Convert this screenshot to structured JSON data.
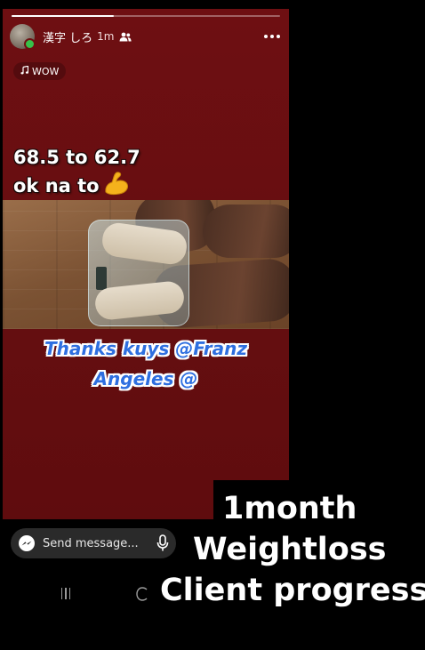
{
  "story": {
    "progress_fraction": 0.38,
    "header": {
      "username": "漢字 しろ",
      "time": "1m",
      "friends_icon": "friends-icon",
      "more_icon": "more-icon"
    },
    "music": {
      "icon": "music-note-icon",
      "label": "WOW"
    },
    "caption": {
      "line1": "68.5 to 62.7",
      "line2": "ok na to",
      "emoji": "💪"
    },
    "thanks": {
      "line1": "Thanks kuys @Franz",
      "line2": "Angeles  @"
    },
    "colors": {
      "background": "#6e0f12",
      "thanks_text": "#2e6fe0",
      "online_dot": "#37c24a"
    }
  },
  "reply": {
    "placeholder": "Send message...",
    "left_icon": "messenger-icon",
    "right_icon": "mic-icon"
  },
  "overlay": {
    "line1": "1month",
    "line2": "Weightloss",
    "line3": "Client progress"
  },
  "system_nav": {
    "recent_icon": "recent-apps-icon",
    "home_icon": "home-icon"
  }
}
